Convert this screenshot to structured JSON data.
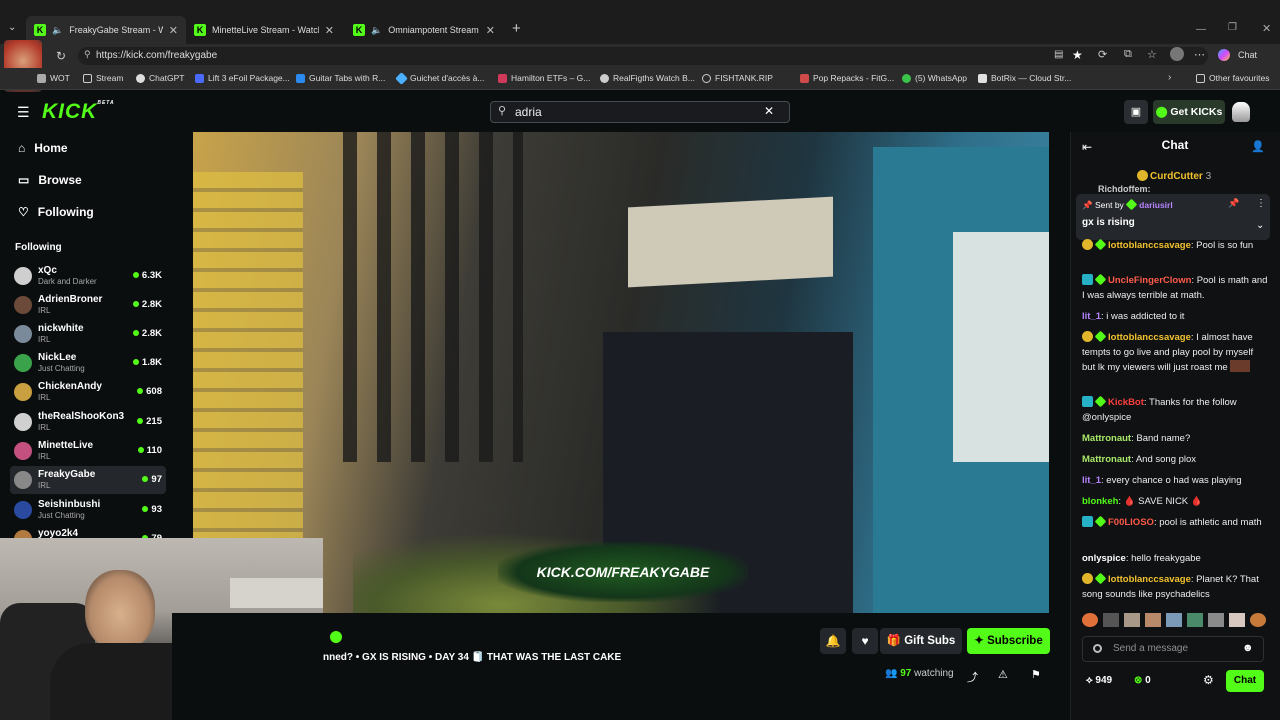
{
  "browser": {
    "tabs": [
      {
        "label": "FreakyGabe Stream - Watch Li",
        "active": true
      },
      {
        "label": "MinetteLive Stream - Watch Live o",
        "active": false
      },
      {
        "label": "Omniampotent Stream - Watc",
        "active": false
      }
    ],
    "url": "https://kick.com/freakygabe",
    "bookmarks": [
      "WOT",
      "Stream",
      "ChatGPT",
      "Lift 3 eFoil Package...",
      "Guitar Tabs with R...",
      "Guichet d'accès à...",
      "Hamilton ETFs – G...",
      "RealFigths Watch B...",
      "FISHTANK.RIP",
      "Pop Repacks - FitG...",
      "(5) WhatsApp",
      "BotRix — Cloud Str...",
      "Other favourites"
    ],
    "chat_label": "Chat"
  },
  "header": {
    "logo": "KICK",
    "logo_badge": "BETA",
    "search_value": "adria",
    "get_kicks": "Get KICKs"
  },
  "nav": {
    "home": "Home",
    "browse": "Browse",
    "following": "Following"
  },
  "sidebar": {
    "following_header": "Following",
    "channels": [
      {
        "name": "xQc",
        "category": "Dark and Darker",
        "viewers": "6.3K",
        "color": "#cfcfcf"
      },
      {
        "name": "AdrienBroner",
        "category": "IRL",
        "viewers": "2.8K",
        "color": "#6b4a3a"
      },
      {
        "name": "nickwhite",
        "category": "IRL",
        "viewers": "2.8K",
        "color": "#7a8a9a"
      },
      {
        "name": "NickLee",
        "category": "Just Chatting",
        "viewers": "1.8K",
        "color": "#3aa24a"
      },
      {
        "name": "ChickenAndy",
        "category": "IRL",
        "viewers": "608",
        "color": "#c8a040"
      },
      {
        "name": "theRealShooKon3",
        "category": "IRL",
        "viewers": "215",
        "color": "#d0d0d0"
      },
      {
        "name": "MinetteLive",
        "category": "IRL",
        "viewers": "110",
        "color": "#c45080"
      },
      {
        "name": "FreakyGabe",
        "category": "IRL",
        "viewers": "97",
        "color": "#888888"
      },
      {
        "name": "Seishinbushi",
        "category": "Just Chatting",
        "viewers": "93",
        "color": "#2a4aa0"
      },
      {
        "name": "yoyo2k4",
        "category": "",
        "viewers": "79",
        "color": "#b07a40"
      }
    ]
  },
  "player": {
    "watermark": "KICK.COM/FREAKYGABE"
  },
  "stream": {
    "title": "nned? • GX IS RISING • DAY 34 🧻 THAT WAS THE LAST CAKE",
    "gift_subs": "Gift Subs",
    "subscribe": "Subscribe",
    "watching_count": "97",
    "watching_label": "watching"
  },
  "chat": {
    "header": "Chat",
    "top_user": "CurdCutter",
    "top_count": "3",
    "partial_user": "Richdoffem:",
    "pinned_prefix": "Sent by",
    "pinned_user": "dariusirl",
    "pinned_text": "gx is rising",
    "messages": [
      {
        "user": "lottoblanccsavage",
        "color": "#f2c230",
        "text": "Pool is so fun",
        "badges": [
          "b-gold",
          "b-green"
        ]
      },
      {
        "user": "UncleFingerClown",
        "color": "#ff5a4a",
        "text": "Pool is math and I was always terrible at math.",
        "badges": [
          "b-cyan",
          "b-green"
        ]
      },
      {
        "user": "lit_1",
        "color": "#b684ff",
        "text": "i was addicted to it",
        "badges": []
      },
      {
        "user": "lottoblanccsavage",
        "color": "#f2c230",
        "text": "I almost have tempts to go live and play pool by myself but lk my viewers will just roast me",
        "badges": [
          "b-gold",
          "b-green"
        ]
      },
      {
        "user": "KickBot",
        "color": "#ff3f3f",
        "text": "Thanks for the follow @onlyspice",
        "badges": [
          "b-cyan",
          "b-green"
        ]
      },
      {
        "user": "Mattronaut",
        "color": "#a8e86a",
        "text": "Band name?",
        "badges": []
      },
      {
        "user": "Mattronaut",
        "color": "#a8e86a",
        "text": "And song plox",
        "badges": []
      },
      {
        "user": "lit_1",
        "color": "#b684ff",
        "text": "every chance o had was playing",
        "badges": []
      },
      {
        "user": "blonkeh",
        "color": "#53fc18",
        "text": "🩸 SAVE NICK 🩸",
        "badges": []
      },
      {
        "user": "F00LIOSO",
        "color": "#ff5a4a",
        "text": "pool is athletic and math",
        "badges": [
          "b-cyan",
          "b-green"
        ]
      },
      {
        "user": "onlyspice",
        "color": "#ffffff",
        "text": "hello freakygabe",
        "badges": []
      },
      {
        "user": "lottoblanccsavage",
        "color": "#f2c230",
        "text": "Planet K? That song sounds like psychadelics",
        "badges": [
          "b-gold",
          "b-green"
        ]
      }
    ],
    "send_placeholder": "Send a message",
    "kicks_count": "949",
    "points_count": "0",
    "chat_button": "Chat"
  }
}
